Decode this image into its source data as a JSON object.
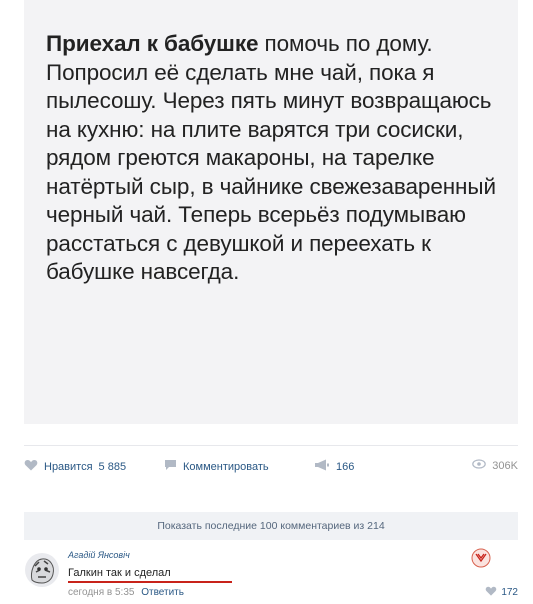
{
  "post": {
    "text_bold": "Приехал к бабушке",
    "text_rest": " помочь по дому. Попросил её сделать мне чай, пока я пылесошу. Через пять минут возвращаюсь на кухню: на плите варятся три сосиски, рядом греются макароны, на тарелке натёртый сыр, в чайнике свежезаваренный черный чай. Теперь всерьёз подумываю расстаться с девушкой и переехать к бабушке навсегда."
  },
  "actions": {
    "like_label": "Нравится",
    "like_count": "5 885",
    "comment_label": "Комментировать",
    "share_count": "166",
    "views": "306K"
  },
  "comments_bar": {
    "show_more": "Показать последние 100 комментариев из 214"
  },
  "comment": {
    "author": "Агадій Янсовіч",
    "text": "Галкин так и сделал",
    "time": "сегодня в 5:35",
    "reply": "Ответить",
    "likes": "172"
  },
  "colors": {
    "accent": "#2a5885",
    "muted": "#939393",
    "underline": "#c8231a",
    "card_bg": "#f3f3f5"
  }
}
